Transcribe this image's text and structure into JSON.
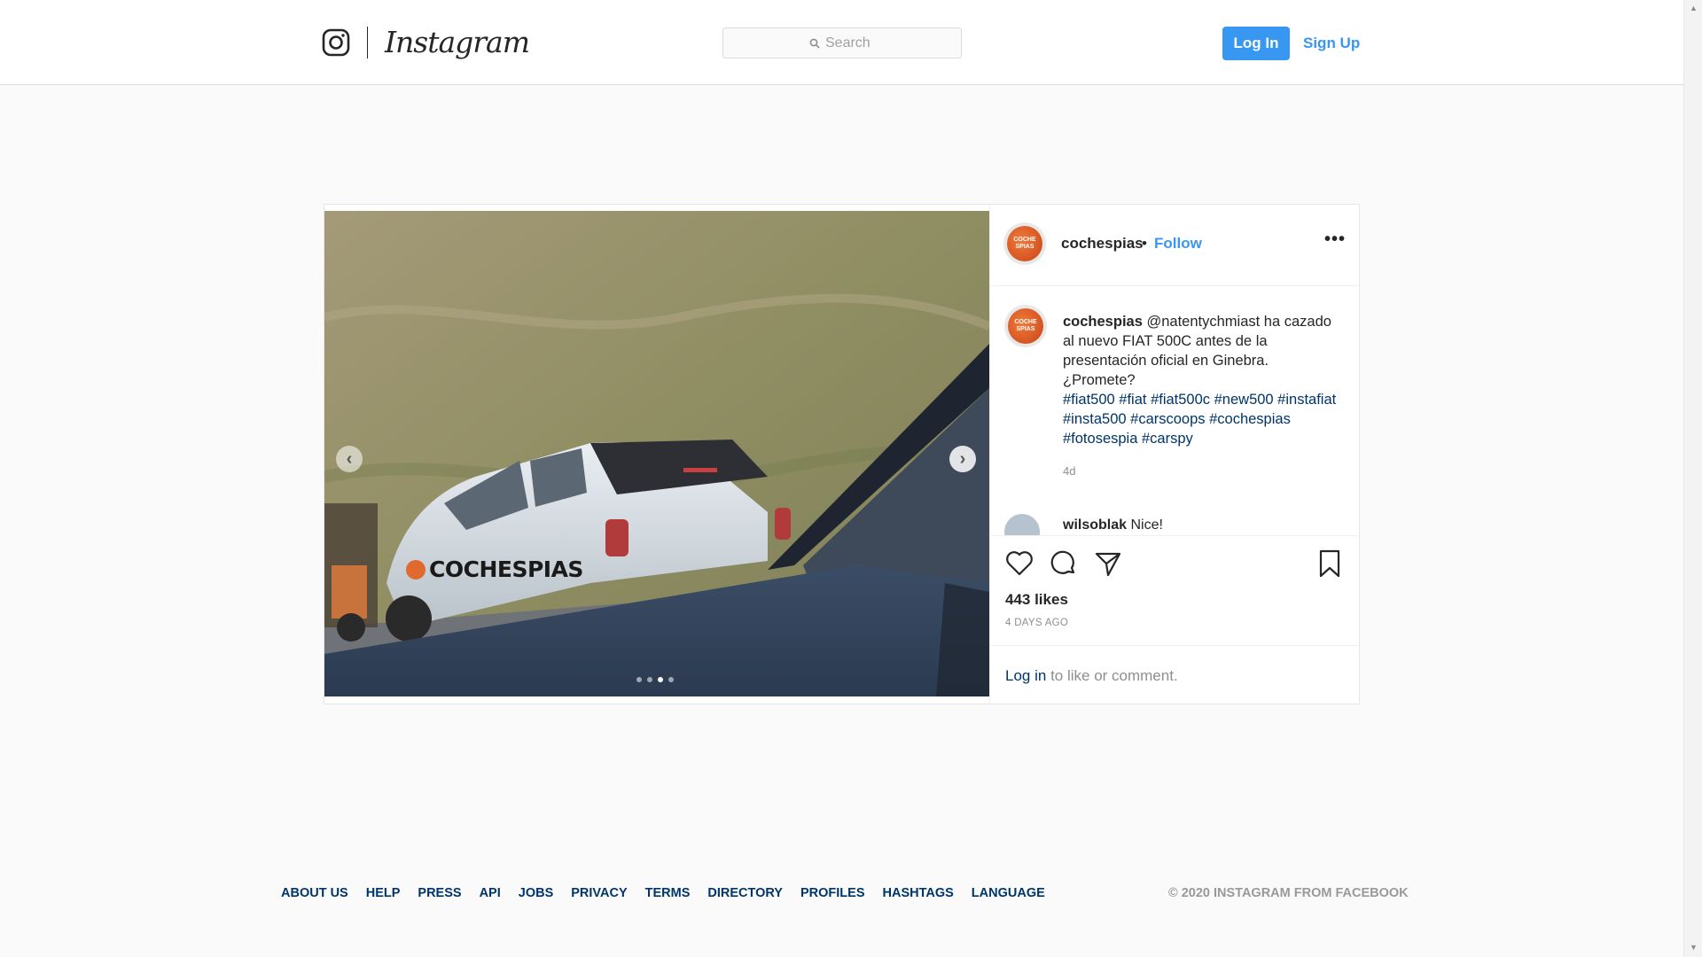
{
  "nav": {
    "wordmark": "Instagram",
    "search_placeholder": "Search",
    "login_label": "Log In",
    "signup_label": "Sign Up",
    "brand_color": "#3897f0"
  },
  "post": {
    "username": "cochespias",
    "separator": "•",
    "follow_label": "Follow",
    "more_label": "•••",
    "avatar_text": "COCHE SPIAS",
    "caption": {
      "username": "cochespias",
      "text": "@natentychmiast ha cazado al nuevo FIAT 500C antes de la presentación oficial en Ginebra. ¿Promete?",
      "hashtags": "#fiat500 #fiat #fiat500c #new500 #instafiat #insta500 #carscoops #cochespias #fotosespia #carspy",
      "time": "4d"
    },
    "next_comment": {
      "username": "wilsoblak",
      "text": "Nice!"
    },
    "media": {
      "watermark": "COCHESPIAS",
      "carousel_count": 4,
      "carousel_active": 3
    },
    "likes": "443 likes",
    "date": "4 DAYS AGO",
    "login_prompt": {
      "link": "Log in",
      "rest": "to like or comment."
    }
  },
  "icons": [
    "instagram-glyph-icon",
    "search-icon",
    "chevron-left-icon",
    "chevron-right-icon",
    "more-icon",
    "heart-icon",
    "comment-icon",
    "share-icon",
    "bookmark-icon"
  ],
  "footer": {
    "links": [
      "ABOUT US",
      "HELP",
      "PRESS",
      "API",
      "JOBS",
      "PRIVACY",
      "TERMS",
      "DIRECTORY",
      "PROFILES",
      "HASHTAGS",
      "LANGUAGE"
    ],
    "copyright": "© 2020 INSTAGRAM FROM FACEBOOK"
  }
}
